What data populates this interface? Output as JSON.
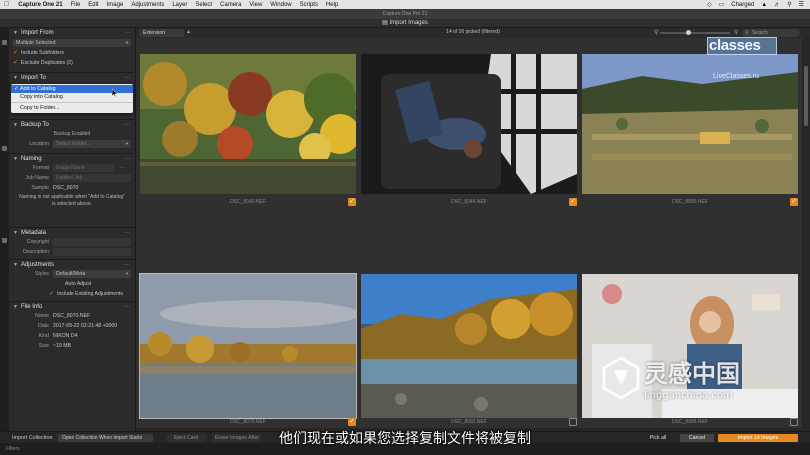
{
  "menubar": {
    "app": "Capture One 21",
    "items": [
      "File",
      "Edit",
      "Image",
      "Adjustments",
      "Layer",
      "Select",
      "Camera",
      "View",
      "Window",
      "Scripts",
      "Help"
    ],
    "battery": "Charged"
  },
  "window": {
    "title": "Capture One Pro 21",
    "dialog_title": "Import Images"
  },
  "sections": {
    "import_from": {
      "title": "Import From",
      "source": "Multiple Selected",
      "include_subfolders": "Include Subfolders",
      "exclude_duplicates": "Exclude Duplicates (2)"
    },
    "import_to": {
      "title": "Import To",
      "menu": [
        "Add to Catalog",
        "Copy into Catalog",
        "Copy to Folder..."
      ],
      "selected": "Add to Catalog"
    },
    "backup_to": {
      "title": "Backup To",
      "status": "Backup Enabled",
      "location_label": "Location",
      "location_value": "Select Folder..."
    },
    "naming": {
      "title": "Naming",
      "format_label": "Format",
      "format_value": "Image Name",
      "job_label": "Job Name",
      "job_value": "Untitled Job",
      "sample_label": "Sample",
      "sample_value": "DSC_8070",
      "note": "Naming is not applicable when \"Add to Catalog\" is selected above."
    },
    "metadata": {
      "title": "Metadata",
      "copyright_label": "Copyright",
      "description_label": "Description"
    },
    "adjustments": {
      "title": "Adjustments",
      "styles_label": "Styles",
      "styles_value": "Default/Meta",
      "auto_adjust": "Auto Adjust",
      "include_existing": "Include Existing Adjustments"
    },
    "file_info": {
      "title": "File Info",
      "name_label": "Name",
      "name_value": "DSC_8070.NEF",
      "date_label": "Date",
      "date_value": "2017-09-22 02:21:48 +0000",
      "kind_label": "Kind",
      "kind_value": "NIKON D4",
      "size_label": "Size",
      "size_value": "~19 MB"
    }
  },
  "toolbar": {
    "filter_value": "Extension",
    "picked_status": "14 of 26 picked (filtered)",
    "search_placeholder": "Search"
  },
  "thumbnails": [
    {
      "caption": "DSC_8340.NEF",
      "checked": true
    },
    {
      "caption": "DSC_8344.NEF",
      "checked": true
    },
    {
      "caption": "DSC_8865.NEF",
      "checked": true
    },
    {
      "caption": "DSC_8070.NEF",
      "checked": true
    },
    {
      "caption": "DSC_8092.NEF",
      "checked": false
    },
    {
      "caption": "DSC_8986.NEF",
      "checked": false
    }
  ],
  "bottombar": {
    "import_collection_label": "Import Collection",
    "collection_value": "Open Collection When Import Starts",
    "eject_card": "Eject Card",
    "erase_images": "Erase Images After",
    "pick_all": "Pick all",
    "cancel": "Cancel",
    "import": "Import 14 Images"
  },
  "footer": {
    "filters": "Filters"
  },
  "overlays": {
    "logo_text": "classes",
    "logo_site": "LiveClasses.ru",
    "subtitle": "他们现在或如果您选择复制文件将被复制",
    "watermark_cn": "灵感中国",
    "watermark_url": "lingganchina.com"
  },
  "colors": {
    "accent": "#e58a1f",
    "menu_selection": "#2f6fd6",
    "panel_bg": "#2b2b2b",
    "grid_bg": "#303030"
  }
}
